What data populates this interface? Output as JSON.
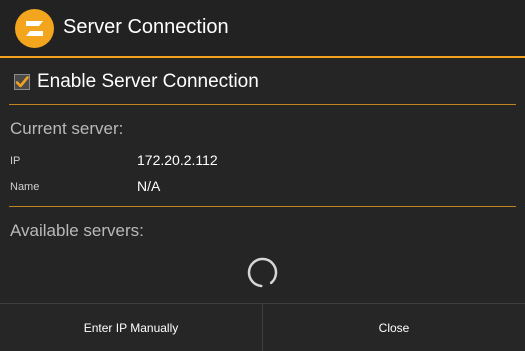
{
  "dialog": {
    "title": "Server Connection",
    "logo_icon": "app-logo-icon",
    "accent_color": "#f2a21d"
  },
  "enable_server": {
    "label": "Enable Server Connection",
    "checked": true
  },
  "current_server": {
    "heading": "Current server:",
    "ip_label": "IP",
    "ip_value": "172.20.2.112",
    "name_label": "Name",
    "name_value": "N/A"
  },
  "available_servers": {
    "heading": "Available servers:",
    "loading_icon": "loading-spinner-icon"
  },
  "buttons": {
    "enter_ip": "Enter IP Manually",
    "close": "Close"
  }
}
